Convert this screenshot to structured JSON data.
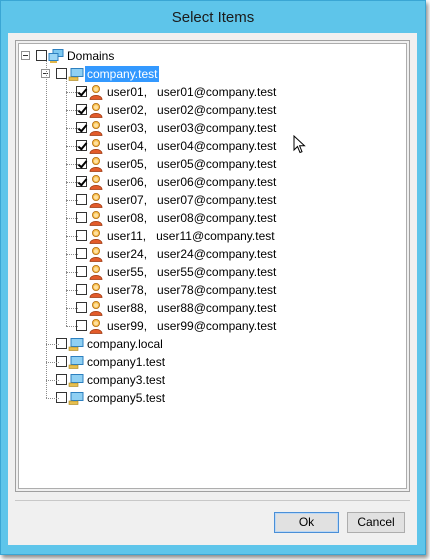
{
  "window": {
    "title": "Select Items"
  },
  "tree": {
    "root": {
      "label": "Domains",
      "checked": false,
      "icon": "domains-icon"
    },
    "domains": [
      {
        "label": "company.test",
        "checked": false,
        "selected": true,
        "expanded": true,
        "icon": "domain-icon",
        "users": [
          {
            "label": "user01,   user01@company.test",
            "checked": true
          },
          {
            "label": "user02,   user02@company.test",
            "checked": true
          },
          {
            "label": "user03,   user03@company.test",
            "checked": true
          },
          {
            "label": "user04,   user04@company.test",
            "checked": true
          },
          {
            "label": "user05,   user05@company.test",
            "checked": true
          },
          {
            "label": "user06,   user06@company.test",
            "checked": true
          },
          {
            "label": "user07,   user07@company.test",
            "checked": false
          },
          {
            "label": "user08,   user08@company.test",
            "checked": false
          },
          {
            "label": "user11,   user11@company.test",
            "checked": false
          },
          {
            "label": "user24,   user24@company.test",
            "checked": false
          },
          {
            "label": "user55,   user55@company.test",
            "checked": false
          },
          {
            "label": "user78,   user78@company.test",
            "checked": false
          },
          {
            "label": "user88,   user88@company.test",
            "checked": false
          },
          {
            "label": "user99,   user99@company.test",
            "checked": false
          }
        ]
      },
      {
        "label": "company.local",
        "checked": false,
        "selected": false,
        "expanded": false,
        "icon": "domain-icon",
        "users": []
      },
      {
        "label": "company1.test",
        "checked": false,
        "selected": false,
        "expanded": false,
        "icon": "domain-icon",
        "users": []
      },
      {
        "label": "company3.test",
        "checked": false,
        "selected": false,
        "expanded": false,
        "icon": "domain-icon",
        "users": []
      },
      {
        "label": "company5.test",
        "checked": false,
        "selected": false,
        "expanded": false,
        "icon": "domain-icon",
        "users": []
      }
    ]
  },
  "buttons": {
    "ok_label": "Ok",
    "cancel_label": "Cancel"
  },
  "colors": {
    "titlebar": "#5ec5ea",
    "selection": "#3399ff",
    "user_icon": "#e8a030",
    "domain_icon": "#4a9fd8"
  }
}
